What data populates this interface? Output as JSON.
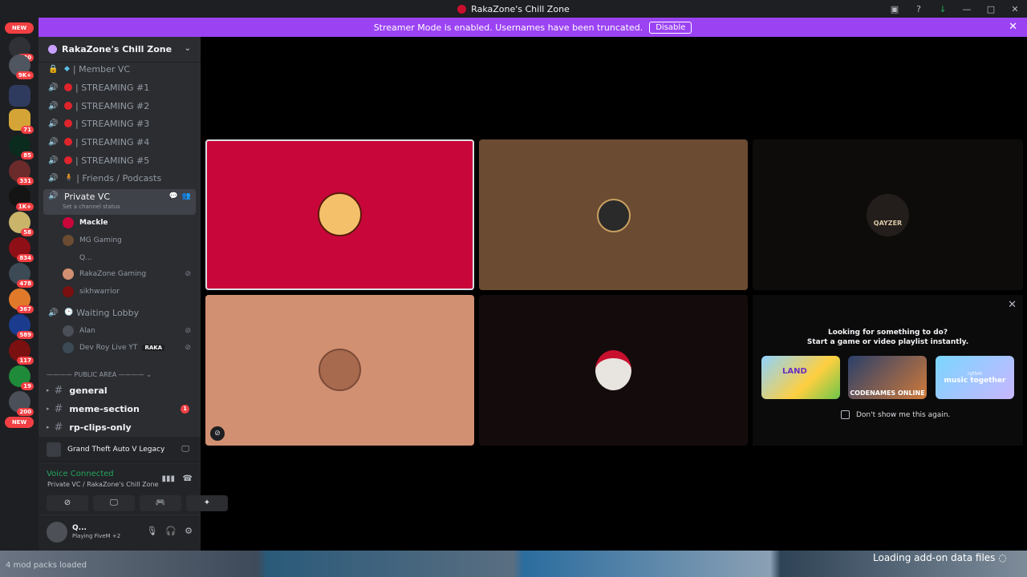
{
  "window": {
    "title": "RakaZone's Chill Zone"
  },
  "banner": {
    "text": "Streamer Mode is enabled. Usernames have been truncated.",
    "button": "Disable"
  },
  "guild_rail": {
    "new_top": "NEW",
    "badges": [
      "220",
      "9K+",
      "71",
      "85",
      "331",
      "1K+",
      "58",
      "834",
      "478",
      "367",
      "589",
      "117",
      "19",
      "200"
    ],
    "new_bottom": "NEW"
  },
  "server": {
    "name": "RakaZone's Chill Zone"
  },
  "channels": {
    "member_vc": "| Member VC",
    "stream1": "| STREAMING #1",
    "stream2": "| STREAMING #2",
    "stream3": "| STREAMING #3",
    "stream4": "| STREAMING #4",
    "stream5": "| STREAMING #5",
    "friends": "| Friends / Podcasts",
    "private_vc": "Private VC",
    "private_status": "Set a channel status",
    "waiting_lobby": "Waiting Lobby"
  },
  "private_members": [
    "Mackle",
    "MG Gaming",
    "Q...",
    "RakaZone Gaming",
    "sikhwarrior"
  ],
  "lobby_members": [
    "Alan",
    "Dev Roy Live YT"
  ],
  "lobby_tag": "RAKA",
  "category": "PUBLIC AREA",
  "text_channels": [
    "general",
    "meme-section",
    "rp-clips-only"
  ],
  "meme_unread": "1",
  "activity": {
    "game": "Grand Theft Auto V Legacy"
  },
  "voice": {
    "status": "Voice Connected",
    "location": "Private VC / RakaZone's Chill Zone"
  },
  "user": {
    "name": "Q...",
    "status": "Playing FiveM",
    "extra": "+2"
  },
  "promo": {
    "title": "Looking for something to do?",
    "subtitle": "Start a game or video playlist instantly.",
    "cards": [
      "LAND",
      "CODENAMES ONLINE",
      "music together"
    ],
    "card_top": "rythm",
    "checkbox": "Don't show me this again."
  },
  "tiles": {
    "logo_text": "QAYZER"
  },
  "bottom": {
    "left": "4 mod packs loaded",
    "right": "Loading add-on data files"
  },
  "colors": {
    "accent": "#9b43f3",
    "tile1": "#c8063a",
    "tile2": "#6b4b32",
    "tile3": "#0e0c0b",
    "tile4": "#d29072",
    "tile5": "#140c0c"
  }
}
